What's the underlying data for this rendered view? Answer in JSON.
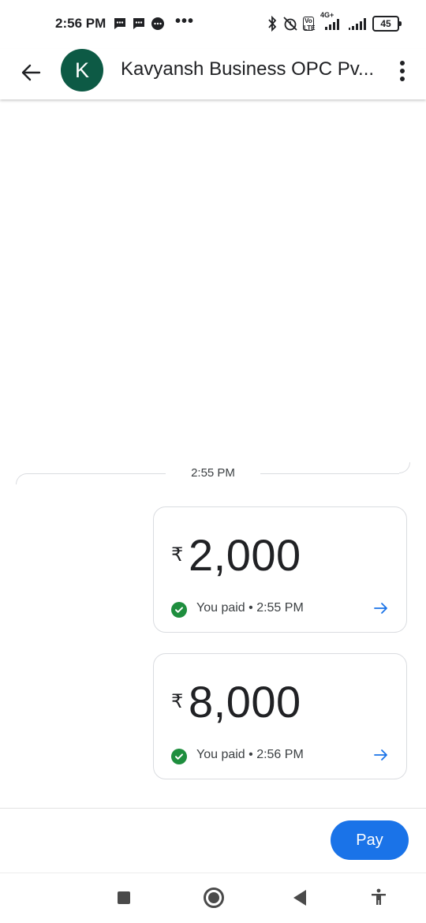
{
  "status_bar": {
    "time": "2:56 PM",
    "overflow": "•••",
    "network_label": "4G+",
    "volte_label": "Vo LTE",
    "battery": "45",
    "icons": [
      "message-icon",
      "message-icon",
      "chat-bubble-icon",
      "bluetooth-icon",
      "alarm-off-icon",
      "signal-icon",
      "signal-icon"
    ]
  },
  "header": {
    "avatar_initial": "K",
    "avatar_color": "#0d5a45",
    "contact_name": "Kavyansh Business OPC Pv..."
  },
  "conversation": {
    "divider_time": "2:55 PM",
    "payments": [
      {
        "currency": "₹",
        "amount": "2,000",
        "status": "You paid • 2:55 PM"
      },
      {
        "currency": "₹",
        "amount": "8,000",
        "status": "You paid • 2:56 PM"
      }
    ]
  },
  "footer": {
    "pay_label": "Pay",
    "accent": "#1a73e8"
  },
  "colors": {
    "success": "#1e8e3e",
    "link": "#1a73e8"
  }
}
